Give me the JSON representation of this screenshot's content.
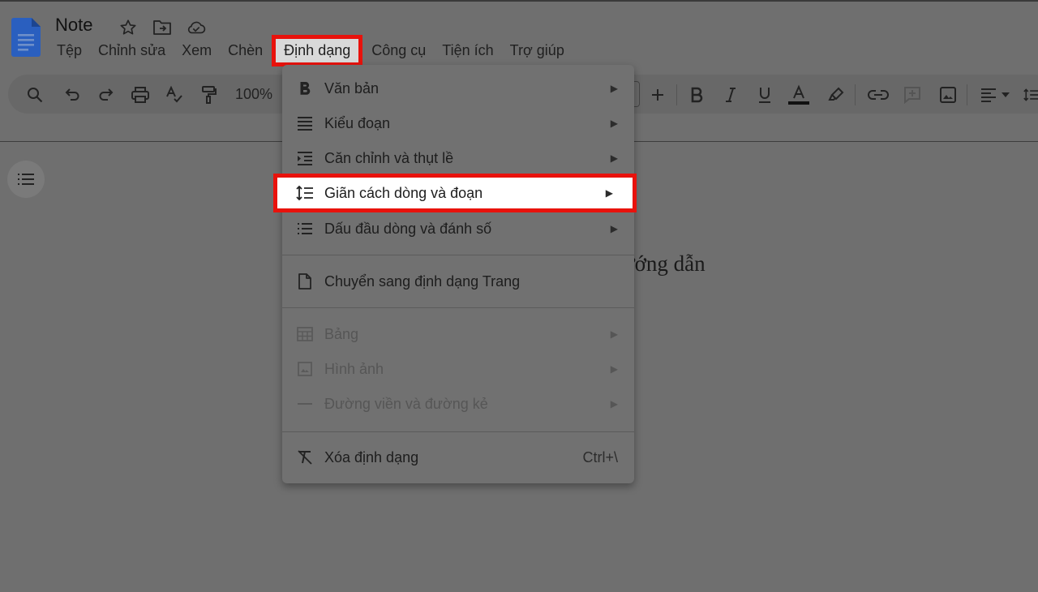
{
  "doc": {
    "title": "Note"
  },
  "menubar": {
    "items": [
      "Tệp",
      "Chỉnh sửa",
      "Xem",
      "Chèn",
      "Định dạng",
      "Công cụ",
      "Tiện ích",
      "Trợ giúp"
    ],
    "active_index": 4
  },
  "toolbar": {
    "zoom": "100%"
  },
  "document": {
    "visible_text": "ướng dẫn"
  },
  "format_menu": {
    "items": [
      {
        "label": "Văn bản",
        "icon": "bold-icon",
        "submenu": true,
        "enabled": true
      },
      {
        "label": "Kiểu đoạn",
        "icon": "paragraph-styles-icon",
        "submenu": true,
        "enabled": true
      },
      {
        "label": "Căn chỉnh và thụt lề",
        "icon": "align-indent-icon",
        "submenu": true,
        "enabled": true
      },
      {
        "label": "Giãn cách dòng và đoạn",
        "icon": "line-spacing-icon",
        "submenu": true,
        "enabled": true,
        "highlighted": true
      },
      {
        "label": "Dấu đầu dòng và đánh số",
        "icon": "bulleted-list-icon",
        "submenu": true,
        "enabled": true
      },
      {
        "label": "Chuyển sang định dạng Trang",
        "icon": "page-icon",
        "submenu": false,
        "enabled": true
      },
      {
        "label": "Bảng",
        "icon": "table-icon",
        "submenu": true,
        "enabled": false
      },
      {
        "label": "Hình ảnh",
        "icon": "image-icon",
        "submenu": true,
        "enabled": false
      },
      {
        "label": "Đường viền và đường kẻ",
        "icon": "border-line-icon",
        "submenu": true,
        "enabled": false
      },
      {
        "label": "Xóa định dạng",
        "icon": "clear-formatting-icon",
        "submenu": false,
        "enabled": true,
        "shortcut": "Ctrl+\\"
      }
    ]
  },
  "colors": {
    "highlight_outline": "#e8120c",
    "docs_blue": "#2a62c9"
  }
}
